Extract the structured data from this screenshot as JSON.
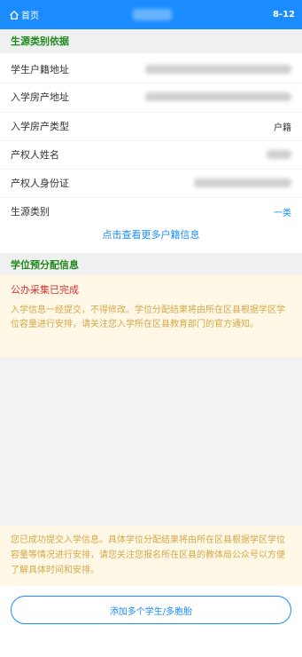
{
  "header": {
    "home_label": "首页",
    "code": "8-12"
  },
  "source_section": {
    "title": "生源类别依据",
    "rows": [
      {
        "label": "学生户籍地址",
        "value": ""
      },
      {
        "label": "入学房产地址",
        "value": ""
      },
      {
        "label": "入学房产类型",
        "value": "户籍"
      },
      {
        "label": "产权人姓名",
        "value": ""
      },
      {
        "label": "产权人身份证",
        "value": ""
      },
      {
        "label": "生源类别",
        "value": "一类"
      }
    ],
    "more_link": "点击查看更多户籍信息"
  },
  "allocation_section": {
    "title": "学位预分配信息",
    "status": "公办采集已完成",
    "message": "入学信息一经提交，不得修改。学位分配结果将由所在区县根据学区学位容量进行安排，请关注您入学所在区县教育部门的官方通知。"
  },
  "bottom_notice": "您已成功提交入学信息。具体学位分配结果将由所在区县根据学区学位容量等情况进行安排，请您关注您报名所在区县的教体局公众号以方便了解具体时间和安排。",
  "add_button_label": "添加多个学生/多胞胎"
}
